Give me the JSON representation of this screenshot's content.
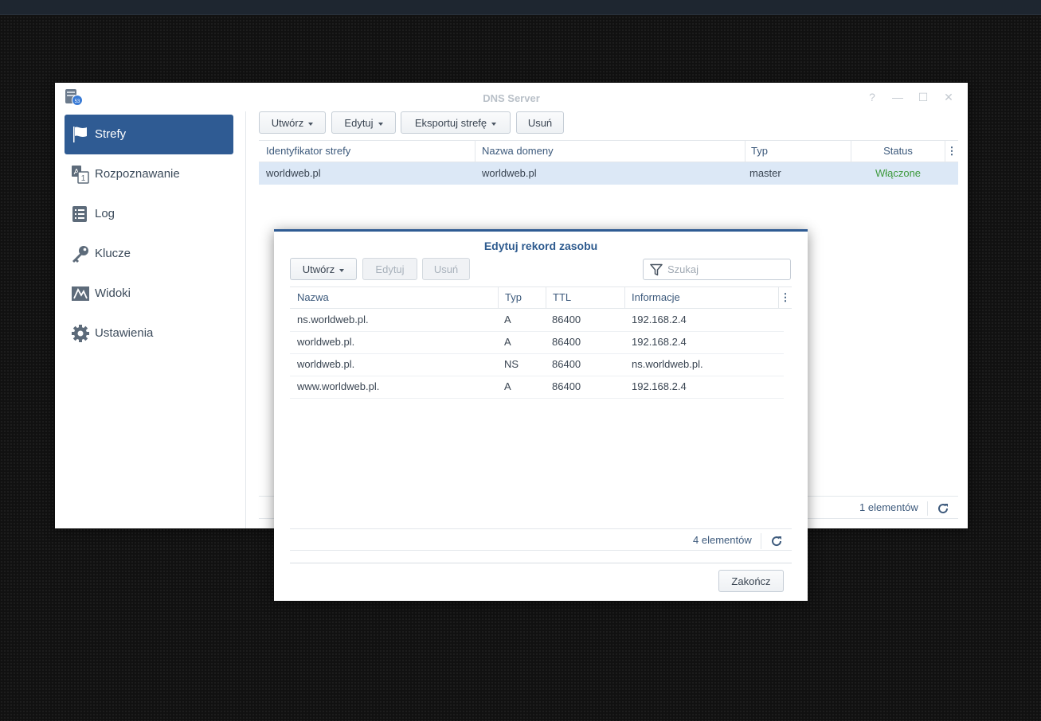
{
  "window": {
    "title": "DNS Server",
    "help": "?",
    "minimize": "—",
    "maximize": "☐",
    "close": "✕"
  },
  "sidebar": {
    "items": [
      {
        "label": "Strefy",
        "icon": "flag-icon",
        "active": true
      },
      {
        "label": "Rozpoznawanie",
        "icon": "resolution-icon"
      },
      {
        "label": "Log",
        "icon": "log-icon"
      },
      {
        "label": "Klucze",
        "icon": "key-icon"
      },
      {
        "label": "Widoki",
        "icon": "map-icon"
      },
      {
        "label": "Ustawienia",
        "icon": "gear-icon"
      }
    ]
  },
  "toolbar": {
    "create": "Utwórz",
    "edit": "Edytuj",
    "export": "Eksportuj strefę",
    "delete": "Usuń"
  },
  "zones_table": {
    "columns": [
      "Identyfikator strefy",
      "Nazwa domeny",
      "Typ",
      "Status"
    ],
    "rows": [
      {
        "id": "worldweb.pl",
        "domain": "worldweb.pl",
        "type": "master",
        "status": "Włączone"
      }
    ],
    "count": "1 elementów"
  },
  "dialog": {
    "title": "Edytuj rekord zasobu",
    "create": "Utwórz",
    "edit": "Edytuj",
    "delete": "Usuń",
    "search_placeholder": "Szukaj",
    "columns": [
      "Nazwa",
      "Typ",
      "TTL",
      "Informacje"
    ],
    "rows": [
      {
        "name": "ns.worldweb.pl.",
        "type": "A",
        "ttl": "86400",
        "info": "192.168.2.4"
      },
      {
        "name": "worldweb.pl.",
        "type": "A",
        "ttl": "86400",
        "info": "192.168.2.4"
      },
      {
        "name": "worldweb.pl.",
        "type": "NS",
        "ttl": "86400",
        "info": "ns.worldweb.pl."
      },
      {
        "name": "www.worldweb.pl.",
        "type": "A",
        "ttl": "86400",
        "info": "192.168.2.4"
      }
    ],
    "count": "4 elementów",
    "finish": "Zakończ"
  },
  "colors": {
    "accent": "#2f5b93",
    "status_enabled": "#3e9a3e",
    "selected_row": "#dce8f6"
  }
}
